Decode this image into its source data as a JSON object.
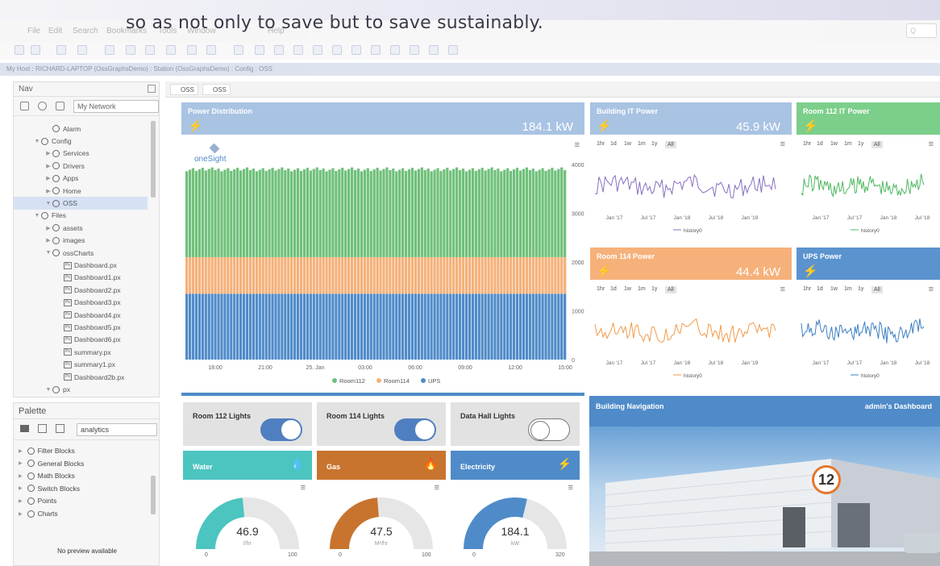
{
  "caption": "so as not only to save but to save sustainably.",
  "menu": {
    "items": [
      "File",
      "Edit",
      "Search",
      "Bookmarks",
      "Tools",
      "Window",
      "Help"
    ],
    "search_placeholder": "Q"
  },
  "path": {
    "text": "My Host : RICHARD-LAPTOP (OssGraphsDemo)   :  Station (OssGraphsDemo)   :  Config   :  OSS"
  },
  "nav": {
    "title": "Nav",
    "network": "My Network",
    "tree": [
      {
        "label": "Alarm",
        "depth": 3,
        "tw": ""
      },
      {
        "label": "Config",
        "depth": 2,
        "tw": "▼"
      },
      {
        "label": "Services",
        "depth": 3,
        "tw": "▶"
      },
      {
        "label": "Drivers",
        "depth": 3,
        "tw": "▶"
      },
      {
        "label": "Apps",
        "depth": 3,
        "tw": "▶"
      },
      {
        "label": "Home",
        "depth": 3,
        "tw": "▶"
      },
      {
        "label": "OSS",
        "depth": 3,
        "tw": "▼",
        "selected": true
      },
      {
        "label": "Files",
        "depth": 2,
        "tw": "▼"
      },
      {
        "label": "assets",
        "depth": 3,
        "tw": "▶"
      },
      {
        "label": "images",
        "depth": 3,
        "tw": "▶"
      },
      {
        "label": "ossCharts",
        "depth": 3,
        "tw": "▼"
      },
      {
        "label": "Dashboard.px",
        "depth": 4,
        "px": true
      },
      {
        "label": "Dashboard1.px",
        "depth": 4,
        "px": true
      },
      {
        "label": "Dashboard2.px",
        "depth": 4,
        "px": true
      },
      {
        "label": "Dashboard3.px",
        "depth": 4,
        "px": true
      },
      {
        "label": "Dashboard4.px",
        "depth": 4,
        "px": true
      },
      {
        "label": "Dashboard5.px",
        "depth": 4,
        "px": true
      },
      {
        "label": "Dashboard6.px",
        "depth": 4,
        "px": true
      },
      {
        "label": "summary.px",
        "depth": 4,
        "px": true
      },
      {
        "label": "summary1.px",
        "depth": 4,
        "px": true
      },
      {
        "label": "Dashboard2b.px",
        "depth": 4,
        "px": true
      },
      {
        "label": "px",
        "depth": 3,
        "tw": "▼"
      }
    ]
  },
  "palette": {
    "title": "Palette",
    "selected": "analytics",
    "items": [
      "Filter Blocks",
      "General Blocks",
      "Math Blocks",
      "Switch Blocks",
      "Points",
      "Charts"
    ],
    "no_preview": "No preview available"
  },
  "main": {
    "tabs": [
      "OSS",
      "OSS"
    ]
  },
  "power_distribution": {
    "title": "Power Distribution",
    "value": "184.1 kW",
    "logo": "oneSight",
    "color": "#a9c3e3",
    "x_ticks": [
      "18:00",
      "21:00",
      "25. Jan",
      "03:00",
      "06:00",
      "09:00",
      "12:00",
      "15:00"
    ],
    "y_ticks": [
      "4000",
      "3000",
      "2000",
      "1000",
      "0"
    ],
    "legend": [
      "Room112",
      "Room114",
      "UPS"
    ],
    "series_colors": [
      "#6fc07a",
      "#f6b17a",
      "#4f8bc9"
    ]
  },
  "building_it": {
    "title": "Building IT Power",
    "value": "45.9 kW",
    "color": "#a9c3e3",
    "line_color": "#8a6fc0",
    "x_ticks": [
      "Jan '17",
      "Jul '17",
      "Jan '18",
      "Jul '18",
      "Jan '19"
    ],
    "legend": "history0"
  },
  "room112": {
    "title": "Room 112 IT Power",
    "value": "",
    "color": "#7ccf8a",
    "line_color": "#4fb860",
    "x_ticks": [
      "Jan '17",
      "Jul '17",
      "Jan '18",
      "Jul '18"
    ],
    "legend": "history0"
  },
  "room114": {
    "title": "Room 114 Power",
    "value": "44.4 kW",
    "color": "#f6b17a",
    "line_color": "#f29a4b",
    "x_ticks": [
      "Jan '17",
      "Jul '17",
      "Jan '18",
      "Jul '18",
      "Jan '19"
    ],
    "legend": "history0"
  },
  "ups": {
    "title": "UPS Power",
    "value": "",
    "color": "#5b93cf",
    "line_color": "#3d7fc0",
    "x_ticks": [
      "Jan '17",
      "Jul '17",
      "Jan '18",
      "Jul '18"
    ],
    "legend": "history0"
  },
  "ranges": [
    "1hr",
    "1d",
    "1w",
    "1m",
    "1y",
    "All"
  ],
  "lights": [
    {
      "label": "Room 112 Lights",
      "state": "on"
    },
    {
      "label": "Room 114 Lights",
      "state": "on"
    },
    {
      "label": "Data Hall Lights",
      "state": "off"
    }
  ],
  "utilities": [
    {
      "label": "Water",
      "icon": "drop-icon",
      "color": "#4cc4c0",
      "value": "46.9",
      "unit": "l/hr",
      "min": "0",
      "max": "100",
      "fraction": 0.469
    },
    {
      "label": "Gas",
      "icon": "flame-icon",
      "color": "#c8742e",
      "value": "47.5",
      "unit": "M³/hr",
      "min": "0",
      "max": "100",
      "fraction": 0.475
    },
    {
      "label": "Electricity",
      "icon": "bolt-icon",
      "color": "#4f8bc9",
      "value": "184.1",
      "unit": "kW",
      "min": "0",
      "max": "320",
      "fraction": 0.575
    }
  ],
  "building_nav": {
    "title": "Building Navigation",
    "user": "admin's Dashboard",
    "sign": "12"
  },
  "chart_data": [
    {
      "type": "bar",
      "title": "Power Distribution",
      "categories": [
        "18:00",
        "21:00",
        "25. Jan",
        "03:00",
        "06:00",
        "09:00",
        "12:00",
        "15:00"
      ],
      "series": [
        {
          "name": "UPS",
          "values": [
            1350,
            1350,
            1350,
            1350,
            1350,
            1350,
            1350,
            1350
          ]
        },
        {
          "name": "Room114",
          "values": [
            750,
            750,
            750,
            750,
            750,
            750,
            750,
            750
          ]
        },
        {
          "name": "Room112",
          "values": [
            1800,
            1800,
            1800,
            1800,
            1800,
            1800,
            1800,
            1800
          ]
        }
      ],
      "ylim": [
        0,
        4000
      ],
      "stacked": true,
      "legend": "bottom"
    }
  ]
}
